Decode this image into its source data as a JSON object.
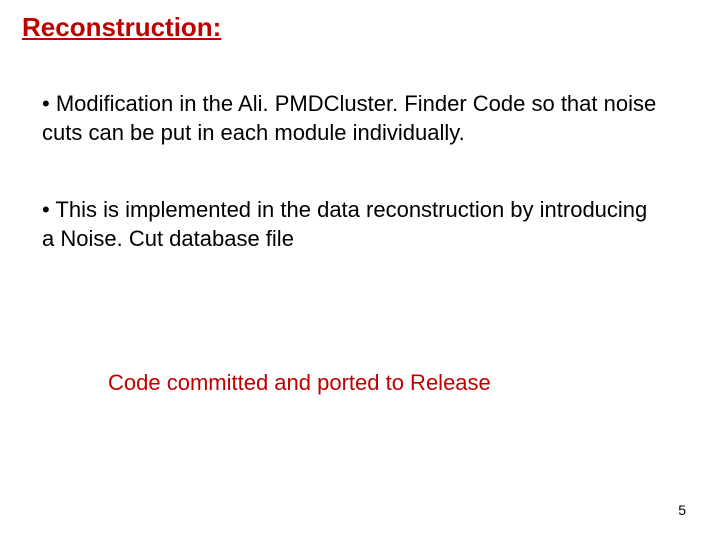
{
  "heading": "Reconstruction:",
  "bullets": [
    "• Modification in the Ali. PMDCluster. Finder Code so that noise cuts can be put in each module individually.",
    "• This is implemented in the data reconstruction by introducing a Noise. Cut database file"
  ],
  "status_line": "Code committed and ported to Release",
  "page_number": "5"
}
